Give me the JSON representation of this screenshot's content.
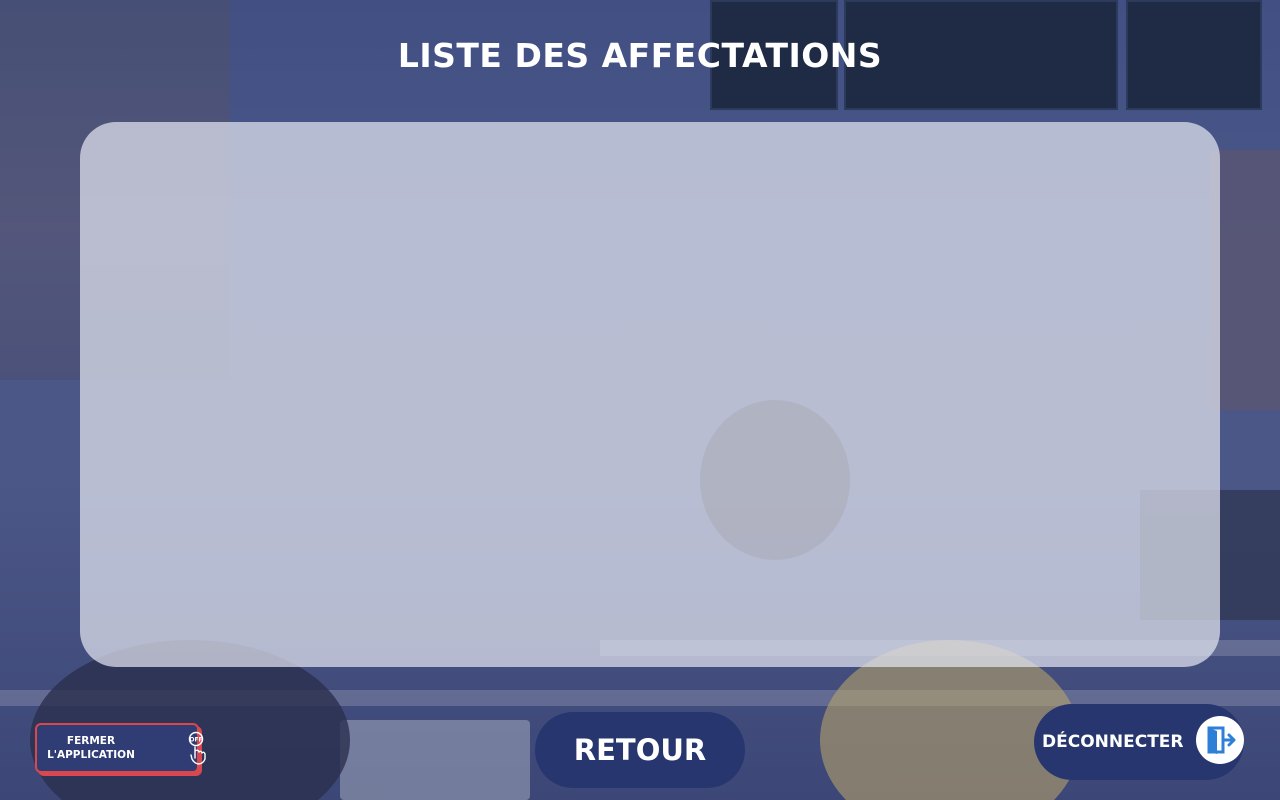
{
  "page": {
    "title": "LISTE DES AFFECTATIONS"
  },
  "buttons": {
    "close_app": {
      "label": "FERMER\nL'APPLICATION",
      "icon": "touch-off-icon"
    },
    "back": {
      "label": "RETOUR"
    },
    "logout": {
      "label": "DÉCONNECTER",
      "icon": "exit-door-icon"
    }
  },
  "colors": {
    "primary": "#27366e",
    "accent": "#d9474f",
    "panel": "#e2e5f0",
    "logout_icon": "#2e7fd6"
  }
}
